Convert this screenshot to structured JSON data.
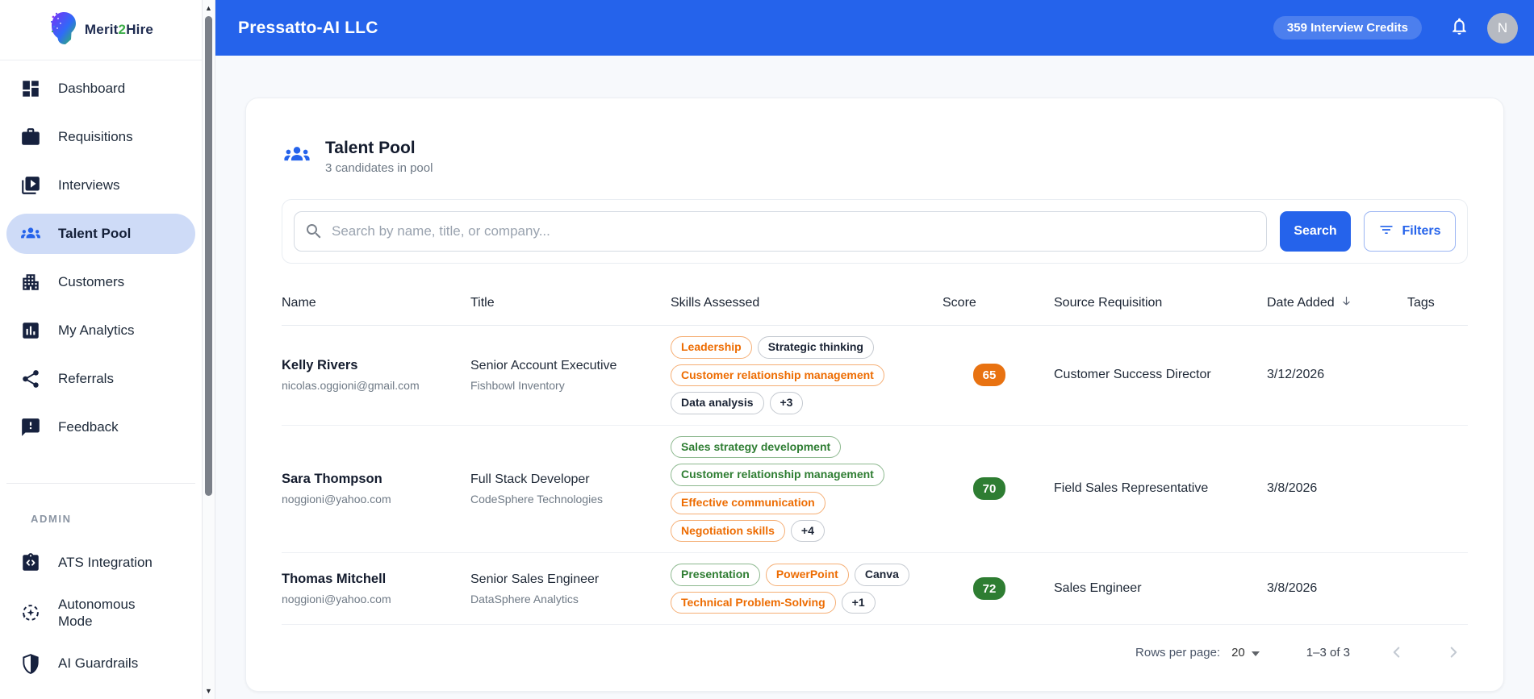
{
  "header": {
    "company": "Pressatto-AI LLC",
    "credits": "359 Interview Credits",
    "avatar_initial": "N"
  },
  "sidebar": {
    "logo_merit": "Merit",
    "logo_two": "2",
    "logo_hire": "Hire",
    "items": [
      {
        "label": "Dashboard",
        "icon": "dashboard-icon"
      },
      {
        "label": "Requisitions",
        "icon": "briefcase-icon"
      },
      {
        "label": "Interviews",
        "icon": "video-library-icon"
      },
      {
        "label": "Talent Pool",
        "icon": "people-group-icon",
        "active": true
      },
      {
        "label": "Customers",
        "icon": "building-icon"
      },
      {
        "label": "My Analytics",
        "icon": "bar-chart-icon"
      },
      {
        "label": "Referrals",
        "icon": "share-icon"
      },
      {
        "label": "Feedback",
        "icon": "feedback-bubble-icon"
      }
    ],
    "admin_label": "ADMIN",
    "admin_items": [
      {
        "label": "ATS Integration",
        "icon": "clipboard-code-icon"
      },
      {
        "label": "Autonomous Mode",
        "icon": "autonomous-sparkle-icon"
      },
      {
        "label": "AI Guardrails",
        "icon": "shield-icon"
      }
    ]
  },
  "pool": {
    "title": "Talent Pool",
    "subtitle": "3 candidates in pool",
    "search_placeholder": "Search by name, title, or company...",
    "search_button": "Search",
    "filters_button": "Filters"
  },
  "table": {
    "columns": [
      "Name",
      "Title",
      "Skills Assessed",
      "Score",
      "Source Requisition",
      "Date Added",
      "Tags"
    ],
    "rows": [
      {
        "name": "Kelly Rivers",
        "email": "nicolas.oggioni@gmail.com",
        "title": "Senior Account Executive",
        "company": "Fishbowl Inventory",
        "skills": [
          {
            "label": "Leadership",
            "color": "orange"
          },
          {
            "label": "Strategic thinking",
            "color": "default"
          },
          {
            "label": "Customer relationship management",
            "color": "orange"
          },
          {
            "label": "Data analysis",
            "color": "default"
          },
          {
            "label": "+3",
            "color": "default"
          }
        ],
        "score": "65",
        "score_color": "orange",
        "source": "Customer Success Director",
        "date": "3/12/2026",
        "tags": ""
      },
      {
        "name": "Sara Thompson",
        "email": "noggioni@yahoo.com",
        "title": "Full Stack Developer",
        "company": "CodeSphere Technologies",
        "skills": [
          {
            "label": "Sales strategy development",
            "color": "green"
          },
          {
            "label": "Customer relationship management",
            "color": "green"
          },
          {
            "label": "Effective communication",
            "color": "orange"
          },
          {
            "label": "Negotiation skills",
            "color": "orange"
          },
          {
            "label": "+4",
            "color": "default"
          }
        ],
        "score": "70",
        "score_color": "green",
        "source": "Field Sales Representative",
        "date": "3/8/2026",
        "tags": ""
      },
      {
        "name": "Thomas Mitchell",
        "email": "noggioni@yahoo.com",
        "title": "Senior Sales Engineer",
        "company": "DataSphere Analytics",
        "skills": [
          {
            "label": "Presentation",
            "color": "green"
          },
          {
            "label": "PowerPoint",
            "color": "orange"
          },
          {
            "label": "Canva",
            "color": "default"
          },
          {
            "label": "Technical Problem-Solving",
            "color": "orange"
          },
          {
            "label": "+1",
            "color": "default"
          }
        ],
        "score": "72",
        "score_color": "green",
        "source": "Sales Engineer",
        "date": "3/8/2026",
        "tags": ""
      }
    ]
  },
  "pagination": {
    "rows_per_page_label": "Rows per page:",
    "rows_per_page_value": "20",
    "range": "1–3 of 3"
  },
  "colors": {
    "topbar": "#2563eb",
    "accent": "#2563eb",
    "sidebar_active_bg": "#cedbf7",
    "chip_orange": "#ed6c02",
    "chip_green": "#2e7d32",
    "score_orange": "#e87211",
    "score_green": "#2e7d32",
    "page_bg": "#f7f9fc",
    "ink": "#16213e"
  }
}
